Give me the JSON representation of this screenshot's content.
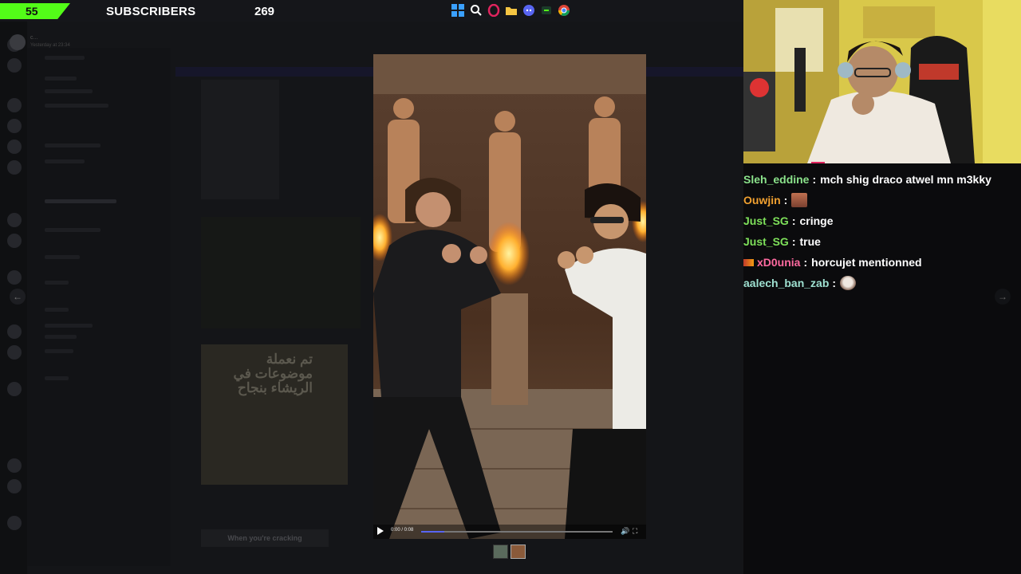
{
  "overlay": {
    "sub_goal_current": "55",
    "subscribers_label": "SUBSCRIBERS",
    "subscribers_total": "269",
    "accent_color": "#53fc18"
  },
  "taskbar": {
    "icons": [
      "windows-start-icon",
      "search-icon",
      "opera-gx-icon",
      "file-explorer-icon",
      "discord-icon",
      "app-icon",
      "chrome-icon"
    ]
  },
  "discord_background": {
    "user_name": "c...",
    "timestamp": "Yesterday at 23:34",
    "meme_text": "تم نعملة موضوعات في الريشاء بنجاح",
    "caption": "When you're cracking"
  },
  "media_viewer": {
    "time": "0:00 / 0:08",
    "progress": 0.12
  },
  "chat": {
    "messages": [
      {
        "user": "Sleh_eddine",
        "color": "#8be28b",
        "text": "mch shig draco atwel mn m3kky",
        "emote": null,
        "badge": false
      },
      {
        "user": "Ouwjin",
        "color": "#f0a030",
        "text": "",
        "emote": "face-emote",
        "badge": false
      },
      {
        "user": "Just_SG",
        "color": "#7ee05a",
        "text": "cringe",
        "emote": null,
        "badge": false
      },
      {
        "user": "Just_SG",
        "color": "#7ee05a",
        "text": "true",
        "emote": null,
        "badge": false
      },
      {
        "user": "xD0unia",
        "color": "#ff6aa0",
        "text": "horcujet mentionned",
        "emote": null,
        "badge": true
      },
      {
        "user": "aalech_ban_zab",
        "color": "#9ee0d0",
        "text": "",
        "emote": "cat-emote",
        "badge": false
      }
    ]
  }
}
